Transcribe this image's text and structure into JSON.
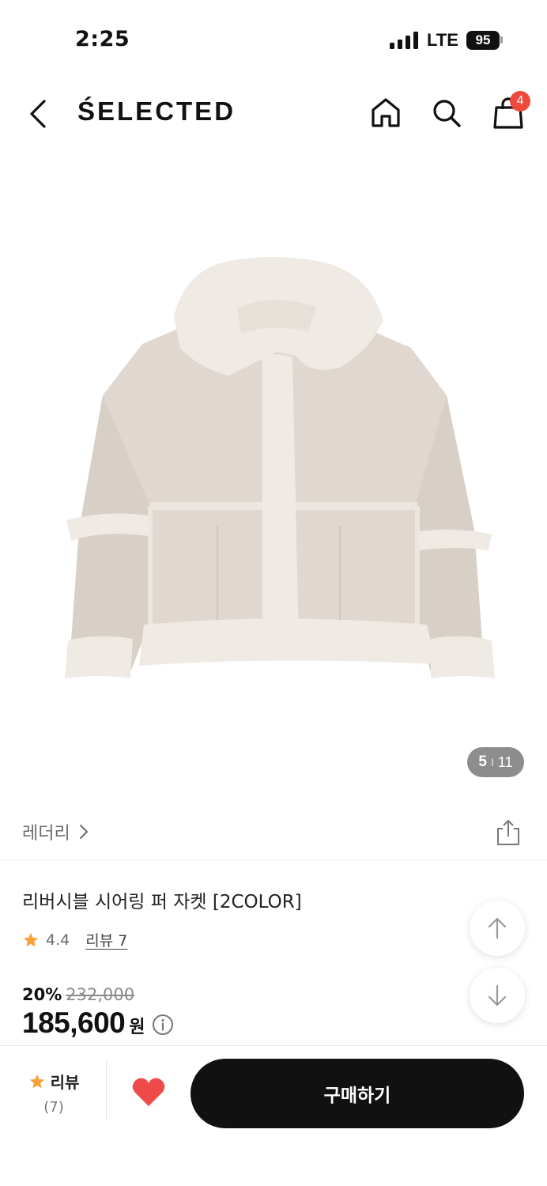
{
  "status_bar": {
    "time": "2:25",
    "network": "LTE",
    "battery": "95"
  },
  "header": {
    "brand": "ŚELECTED",
    "cart_count": "4",
    "icons": [
      "chevron-left-icon",
      "home-icon",
      "search-icon",
      "shopping-bag-icon"
    ]
  },
  "gallery": {
    "current": "5",
    "separator": "I",
    "total": "11"
  },
  "brand_row": {
    "brand_name": "레더리",
    "icons": [
      "chevron-right-icon",
      "share-icon"
    ]
  },
  "product": {
    "name": "리버시블 시어링 퍼 자켓 [2COLOR]",
    "rating": "4.4",
    "review_link": "리뷰 7",
    "discount_rate": "20%",
    "original_price": "232,000",
    "sale_price": "185,600",
    "currency": "원"
  },
  "bottom_bar": {
    "review_label": "리뷰",
    "review_count": "(7)",
    "buy_label": "구매하기",
    "colors": {
      "star": "#f6a23a",
      "heart": "#ee4a4a",
      "buy_button": "#111111"
    }
  }
}
